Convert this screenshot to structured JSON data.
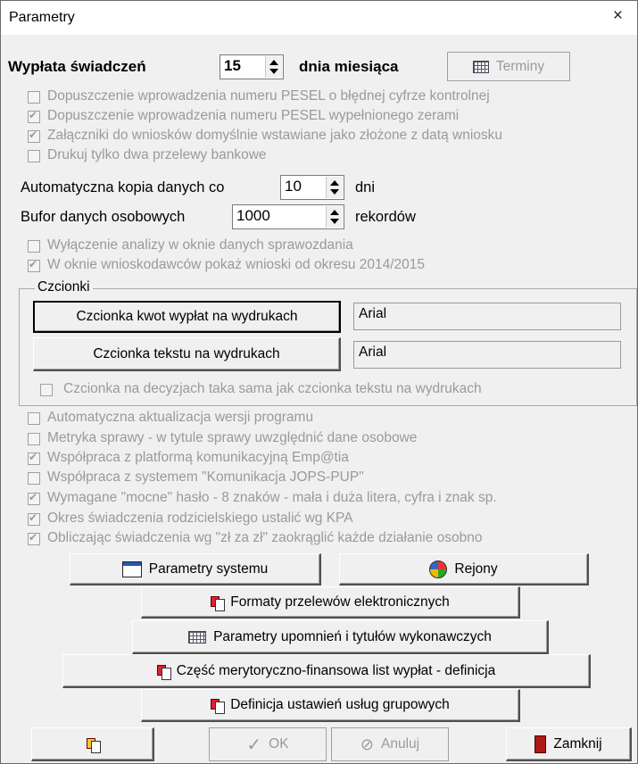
{
  "window": {
    "title": "Parametry",
    "close_glyph": "×"
  },
  "payment": {
    "label_before": "Wypłata świadczeń",
    "day_value": "15",
    "label_after": "dnia miesiąca",
    "terminy_button": "Terminy"
  },
  "checks_top": [
    {
      "label": "Dopuszczenie wprowadzenia numeru PESEL o błędnej cyfrze kontrolnej",
      "checked": false
    },
    {
      "label": "Dopuszczenie wprowadzenia numeru PESEL wypełnionego zerami",
      "checked": true
    },
    {
      "label": "Załączniki do wniosków domyślnie wstawiane jako złożone z datą wniosku",
      "checked": true
    },
    {
      "label": "Drukuj tylko dwa przelewy bankowe",
      "checked": false
    }
  ],
  "backup": {
    "label": "Automatyczna kopia danych co",
    "value": "10",
    "unit": "dni"
  },
  "buffer": {
    "label": "Bufor danych osobowych",
    "value": "1000",
    "unit": "rekordów"
  },
  "checks_mid": [
    {
      "label": "Wyłączenie analizy w oknie danych sprawozdania",
      "checked": false
    },
    {
      "label": "W oknie wnioskodawców pokaż wnioski od okresu 2014/2015",
      "checked": true
    }
  ],
  "fonts": {
    "group_label": "Czcionki",
    "amounts_button": "Czcionka kwot wypłat na wydrukach",
    "amounts_value": "Arial",
    "text_button": "Czcionka tekstu na wydrukach",
    "text_value": "Arial",
    "same_check": {
      "label": "Czcionka na decyzjach taka sama jak czcionka tekstu na wydrukach",
      "checked": false
    }
  },
  "checks_bottom": [
    {
      "label": "Automatyczna aktualizacja wersji programu",
      "checked": false
    },
    {
      "label": "Metryka sprawy - w tytule sprawy uwzględnić dane osobowe",
      "checked": false
    },
    {
      "label": "Współpraca z platformą komunikacyjną Emp@tia",
      "checked": true
    },
    {
      "label": "Współpraca z systemem \"Komunikacja JOPS-PUP\"",
      "checked": false
    },
    {
      "label": "Wymagane \"mocne\" hasło - 8 znaków - mała i duża litera, cyfra i znak sp.",
      "checked": true
    },
    {
      "label": "Okres świadczenia rodzicielskiego ustalić wg KPA",
      "checked": true
    },
    {
      "label": "Obliczając świadczenia wg \"zł za zł\"  zaokrąglić każde działanie osobno",
      "checked": true
    }
  ],
  "buttons": {
    "system_params": "Parametry systemu",
    "regions": "Rejony",
    "transfer_formats": "Formaty przelewów elektronicznych",
    "reminder_params": "Parametry upomnień i tytułów wykonawczych",
    "payroll_part": "Część merytoryczno-finansowa list wypłat - definicja",
    "group_services": "Definicja ustawień usług grupowych",
    "ok": "OK",
    "cancel": "Anuluj",
    "close": "Zamknij"
  },
  "icons": {
    "terminy": "calendar-grid-icon",
    "system_params": "window-icon",
    "regions": "world-icon",
    "docs": "documents-icon",
    "reminders": "table-icon",
    "tool": "edit-icon",
    "ok": "check-icon",
    "cancel": "no-entry-icon",
    "close": "exit-door-icon"
  }
}
